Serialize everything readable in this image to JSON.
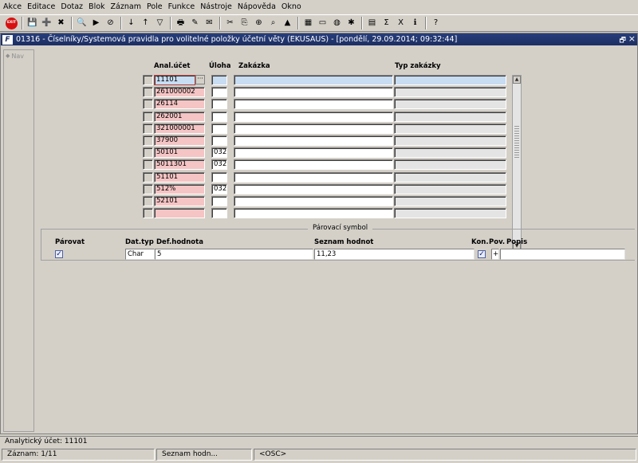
{
  "menu": [
    "Akce",
    "Editace",
    "Dotaz",
    "Blok",
    "Záznam",
    "Pole",
    "Funkce",
    "Nástroje",
    "Nápověda",
    "Okno"
  ],
  "toolbar": {
    "exit_label": "EXIT",
    "buttons": [
      {
        "name": "save-icon",
        "glyph": "💾"
      },
      {
        "name": "new-record-icon",
        "glyph": "➕"
      },
      {
        "name": "delete-record-icon",
        "glyph": "✖"
      },
      {
        "name": "query-icon",
        "glyph": "🔍"
      },
      {
        "name": "execute-query-icon",
        "glyph": "▶"
      },
      {
        "name": "cancel-query-icon",
        "glyph": "⊘"
      },
      {
        "name": "sort-asc-icon",
        "glyph": "↓"
      },
      {
        "name": "sort-desc-icon",
        "glyph": "↑"
      },
      {
        "name": "filter-icon",
        "glyph": "▽"
      },
      {
        "name": "print-icon",
        "glyph": "🖶"
      },
      {
        "name": "edit-icon",
        "glyph": "✎"
      },
      {
        "name": "mail-icon",
        "glyph": "✉"
      },
      {
        "name": "cut-icon",
        "glyph": "✂"
      },
      {
        "name": "copy-icon",
        "glyph": "⎘"
      },
      {
        "name": "zoom-icon",
        "glyph": "⊕"
      },
      {
        "name": "find-icon",
        "glyph": "⌕"
      },
      {
        "name": "triangle-icon",
        "glyph": "▲"
      },
      {
        "name": "chart-icon",
        "glyph": "▦"
      },
      {
        "name": "document-icon",
        "glyph": "▭"
      },
      {
        "name": "globe-icon",
        "glyph": "◍"
      },
      {
        "name": "wheel-icon",
        "glyph": "✱"
      },
      {
        "name": "calculator-icon",
        "glyph": "▤"
      },
      {
        "name": "sum-icon",
        "glyph": "Σ"
      },
      {
        "name": "excel-icon",
        "glyph": "X"
      },
      {
        "name": "info-icon",
        "glyph": "ℹ"
      },
      {
        "name": "help-icon",
        "glyph": "?"
      }
    ]
  },
  "window": {
    "title": "01316 - Číselníky/Systemová pravidla pro volitelné položky účetní věty (EKUSAUS) - [pondělí, 29.09.2014; 09:32:44]",
    "icon_letter": "F",
    "restore_glyph": "🗗",
    "close_glyph": "×"
  },
  "nav": {
    "label": "Nav",
    "icon_glyph": "◆"
  },
  "grid": {
    "headers": {
      "anal_ucet": "Anal.účet",
      "uloha": "Úloha",
      "zakazka": "Zakázka",
      "typ_zakazky": "Typ zakázky"
    },
    "rows": [
      {
        "anal": "11101",
        "uloha": "",
        "zakazka": "",
        "typ": ""
      },
      {
        "anal": "261000002",
        "uloha": "",
        "zakazka": "",
        "typ": ""
      },
      {
        "anal": "26114",
        "uloha": "",
        "zakazka": "",
        "typ": ""
      },
      {
        "anal": "262001",
        "uloha": "",
        "zakazka": "",
        "typ": ""
      },
      {
        "anal": "321000001",
        "uloha": "",
        "zakazka": "",
        "typ": ""
      },
      {
        "anal": "37900",
        "uloha": "",
        "zakazka": "",
        "typ": ""
      },
      {
        "anal": "50101",
        "uloha": "032",
        "zakazka": "",
        "typ": ""
      },
      {
        "anal": "5011301",
        "uloha": "032",
        "zakazka": "",
        "typ": ""
      },
      {
        "anal": "51101",
        "uloha": "",
        "zakazka": "",
        "typ": ""
      },
      {
        "anal": "512%",
        "uloha": "032",
        "zakazka": "",
        "typ": ""
      },
      {
        "anal": "52101",
        "uloha": "",
        "zakazka": "",
        "typ": ""
      },
      {
        "anal": "",
        "uloha": "",
        "zakazka": "",
        "typ": ""
      }
    ],
    "lov_glyph": "···",
    "scroll_up_glyph": "▲",
    "scroll_down_glyph": "▼"
  },
  "parovaci": {
    "title": "Párovací symbol",
    "headers": {
      "parovat": "Párovat",
      "dat_typ": "Dat.typ",
      "def_hodnota": "Def.hodnota",
      "seznam_hodnot": "Seznam hodnot",
      "kon": "Kon.",
      "pov": "Pov.",
      "popis": "Popis"
    },
    "parovat_checked": "✓",
    "dat_typ": "Char",
    "def_hodnota": "5",
    "seznam_hodnot": "11,23",
    "kon_checked": "✓",
    "pov_value": "+",
    "popis": ""
  },
  "status": {
    "line1": "Analytický účet: 11101",
    "zaznam": "Záznam: 1/11",
    "hint": "Seznam hodn...",
    "mode": "<OSC>"
  }
}
